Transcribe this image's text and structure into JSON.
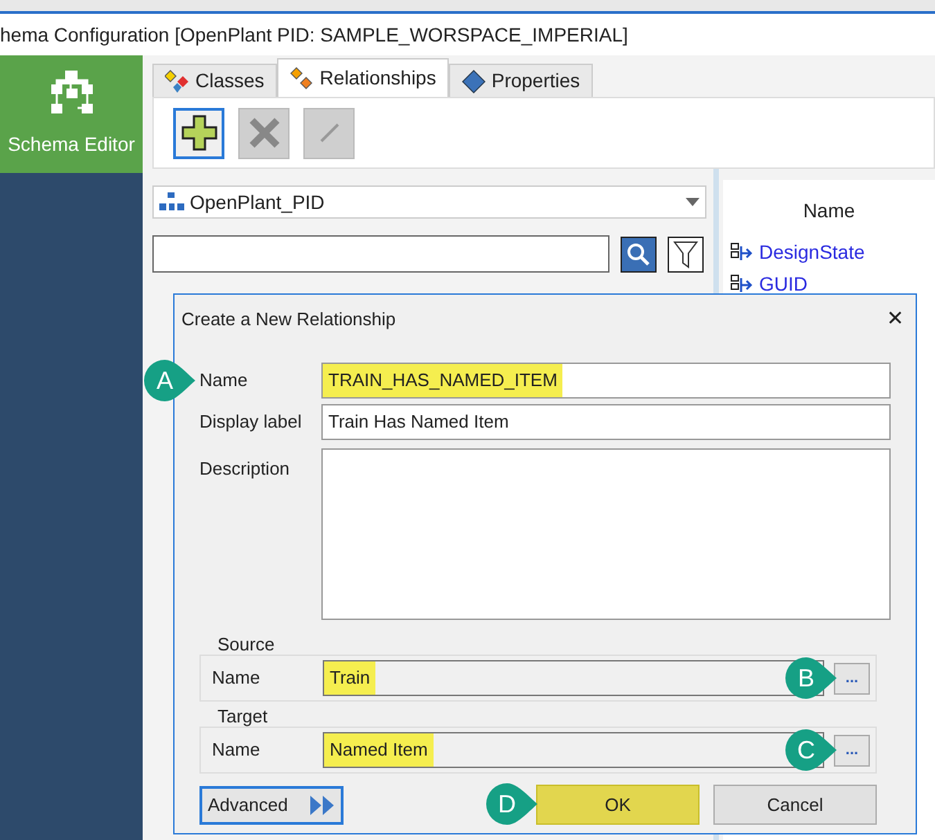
{
  "window": {
    "title": "hema Configuration [OpenPlant PID: SAMPLE_WORSPACE_IMPERIAL]"
  },
  "sidebar": {
    "items": [
      {
        "label": "Schema Editor",
        "selected": true
      }
    ]
  },
  "tabs": [
    {
      "label": "Classes",
      "selected": false,
      "kind": "classes"
    },
    {
      "label": "Relationships",
      "selected": true,
      "kind": "relationships"
    },
    {
      "label": "Properties",
      "selected": false,
      "kind": "properties"
    }
  ],
  "toolbar": [
    {
      "kind": "add",
      "disabled": false,
      "selected": true
    },
    {
      "kind": "delete",
      "disabled": true,
      "selected": false
    },
    {
      "kind": "edit",
      "disabled": true,
      "selected": false
    }
  ],
  "schema_dropdown": {
    "value": "OpenPlant_PID"
  },
  "property_list": {
    "header": "Name",
    "items": [
      "DesignState",
      "GUID"
    ]
  },
  "dialog": {
    "title": "Create a New Relationship",
    "close": "✕",
    "fields": [
      {
        "label": "Name",
        "value": "TRAIN_HAS_NAMED_ITEM",
        "highlighted": true,
        "callout": "A"
      },
      {
        "label": "Display label",
        "value": "Train Has Named Item",
        "highlighted": false
      }
    ],
    "description": {
      "label": "Description"
    },
    "groups": [
      {
        "title": "Source",
        "label": "Name",
        "value": "Train",
        "highlighted": true,
        "browse": "...",
        "callout": "B"
      },
      {
        "title": "Target",
        "label": "Name",
        "value": "Named Item",
        "highlighted": true,
        "browse": "...",
        "callout": "C"
      }
    ],
    "advanced": {
      "label": "Advanced"
    },
    "buttons": [
      {
        "label": "OK",
        "highlighted": true,
        "callout": "D"
      },
      {
        "label": "Cancel",
        "highlighted": false
      }
    ]
  }
}
